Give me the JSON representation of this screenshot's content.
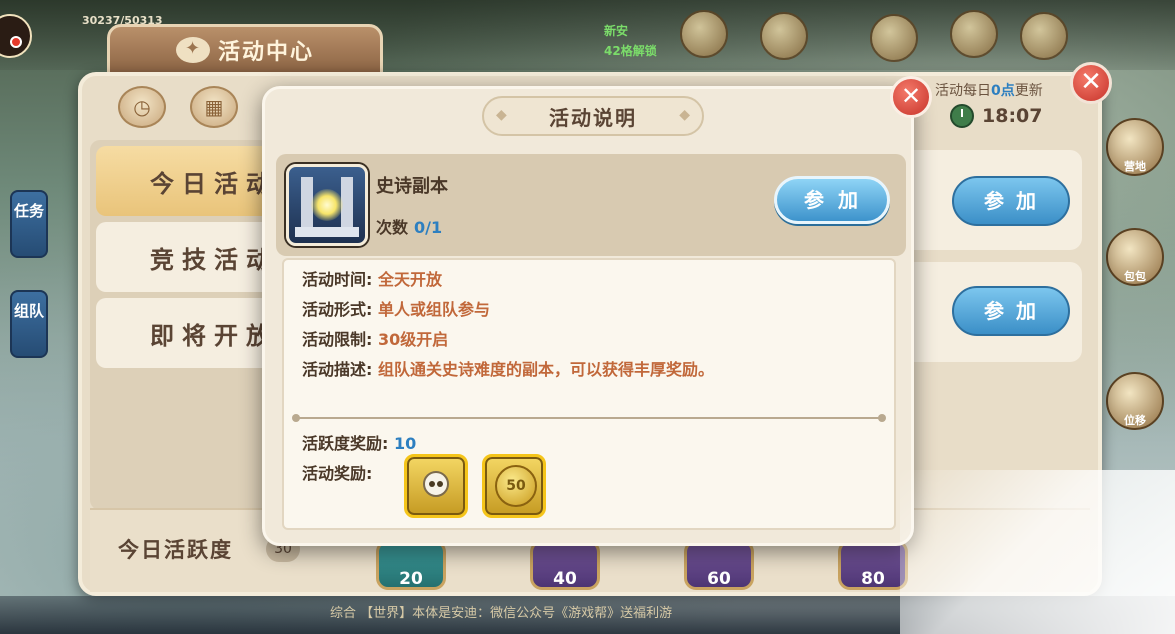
{
  "hud": {
    "top_score": "30237/50313",
    "top_green_1": "新安",
    "top_green_2": "42格解锁"
  },
  "side_tabs": [
    {
      "label": "任务"
    },
    {
      "label": "组队"
    }
  ],
  "side_right": [
    {
      "label": "营地"
    },
    {
      "label": "包包"
    },
    {
      "label": "位移"
    }
  ],
  "activity_center": {
    "title": "活动中心",
    "tabs": [
      {
        "label": "今日活动",
        "active": true
      },
      {
        "label": "竞技活动",
        "active": false
      },
      {
        "label": "即将开放",
        "active": false
      }
    ],
    "refresh_note_prefix": "活动每日",
    "refresh_note_highlight": "0点",
    "refresh_note_suffix": "更新",
    "timer": "18:07",
    "row_join_label_1": "参加",
    "row_join_label_2": "参加",
    "daily_activity_label": "今日活跃度",
    "daily_activity_score": "30",
    "milestones": [
      "20",
      "40",
      "60",
      "80"
    ]
  },
  "chat": {
    "text": "综合  【世界】本体是安迪：微信公众号《游戏帮》送福利游"
  },
  "dialog": {
    "title": "活动说明",
    "activity_name": "史诗副本",
    "count_label": "次数",
    "count_value": "0/1",
    "join_label": "参加",
    "rows": [
      {
        "label": "活动时间:",
        "value": "全天开放"
      },
      {
        "label": "活动形式:",
        "value": "单人或组队参与"
      },
      {
        "label": "活动限制:",
        "value": "30级开启"
      },
      {
        "label": "活动描述:",
        "value": "组队通关史诗难度的副本，可以获得丰厚奖励。"
      }
    ],
    "activity_points_label": "活跃度奖励:",
    "activity_points_value": "10",
    "rewards_label": "活动奖励:",
    "rewards": [
      {
        "icon": "skull-token-icon"
      },
      {
        "icon": "gold-coin-icon",
        "text": "50"
      }
    ]
  },
  "colors": {
    "accent_blue": "#2d7fc0",
    "value_orange": "#c1683a",
    "panel_bg": "#e8ddc8",
    "close_red": "#c7332a"
  }
}
